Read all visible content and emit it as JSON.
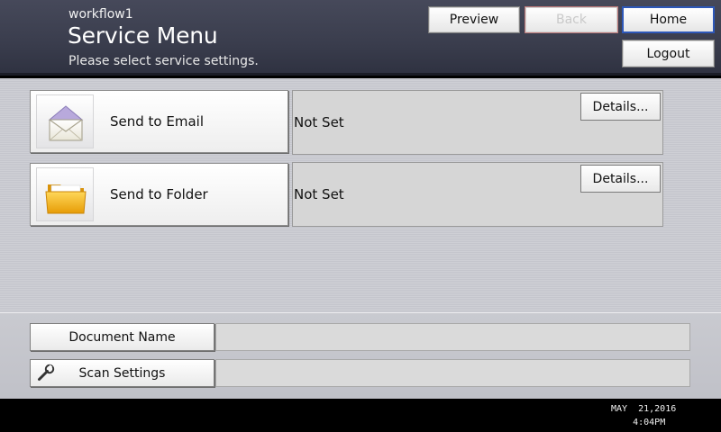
{
  "header": {
    "workflow_name": "workflow1",
    "title": "Service Menu",
    "subtitle": "Please select service settings.",
    "buttons": {
      "preview": "Preview",
      "back": "Back",
      "home": "Home",
      "logout": "Logout"
    }
  },
  "services": [
    {
      "label": "Send to Email",
      "status": "Not Set",
      "details_label": "Details...",
      "icon": "envelope-icon"
    },
    {
      "label": "Send to Folder",
      "status": "Not Set",
      "details_label": "Details...",
      "icon": "folder-icon"
    }
  ],
  "fields": {
    "document_name": {
      "label": "Document Name",
      "value": ""
    },
    "scan_settings": {
      "label": "Scan Settings",
      "value": "",
      "icon": "wrench-icon"
    }
  },
  "footer": {
    "date": "MAY  21,2016",
    "time": "4:04PM"
  },
  "colors": {
    "header_bg": "#3a3d4d",
    "home_border": "#2d57b8",
    "back_border": "#c07a7a",
    "folder_yellow": "#f2b416"
  }
}
